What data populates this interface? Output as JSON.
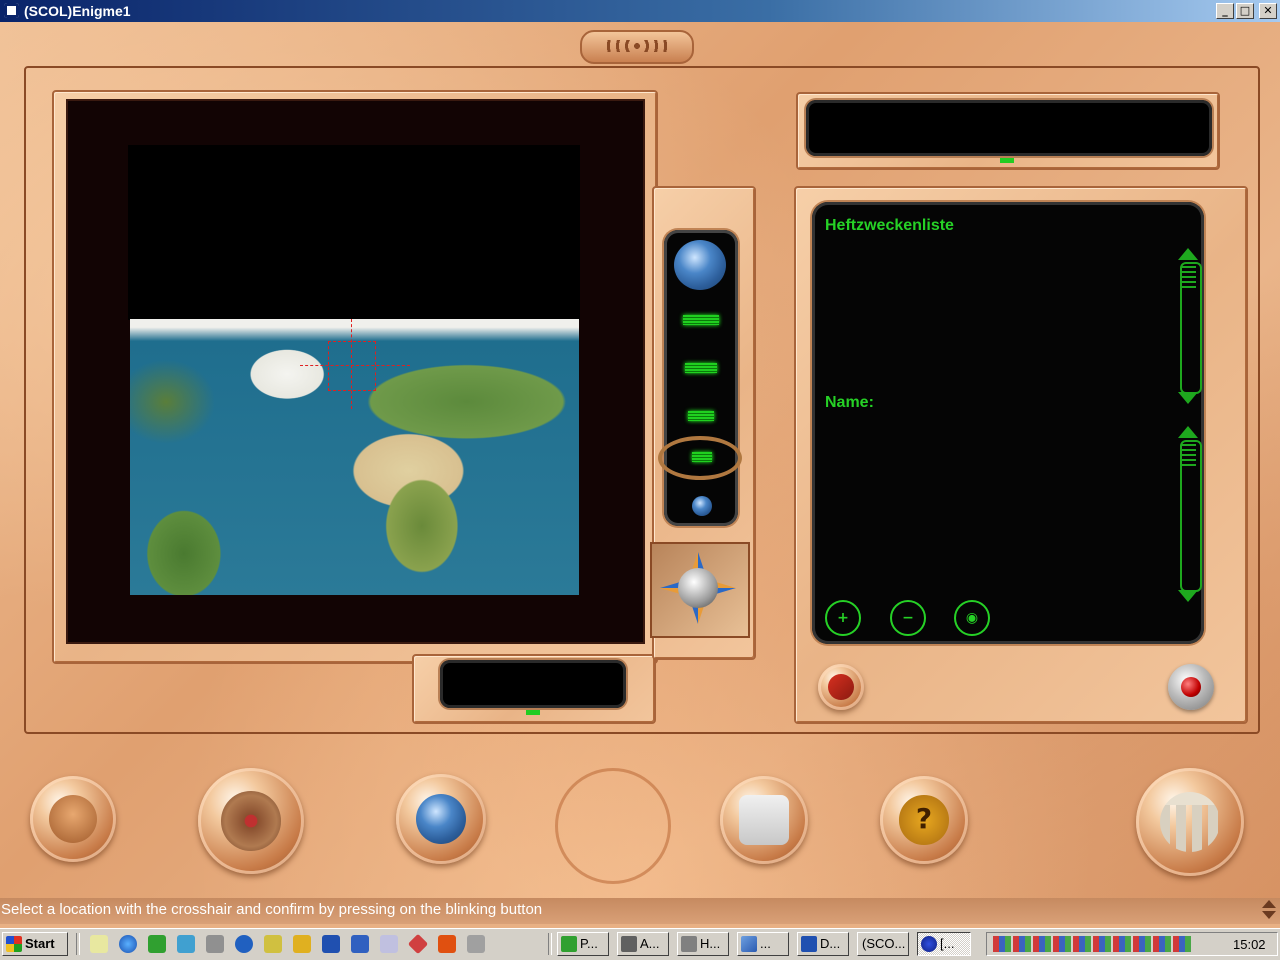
{
  "window": {
    "title": "(SCOL)Enigme1",
    "min": "_",
    "max": "□",
    "close": "✕"
  },
  "pin_panel": {
    "title": "Heftzweckenliste",
    "name_label": "Name:"
  },
  "status_bar": {
    "text": "Select a location with the crosshair and confirm by pressing on the blinking button"
  },
  "taskbar": {
    "start": "Start",
    "tasks": [
      {
        "label": "P..."
      },
      {
        "label": "A..."
      },
      {
        "label": "H..."
      },
      {
        "label": "..."
      },
      {
        "label": "D..."
      },
      {
        "label": "(SCO..."
      },
      {
        "label": "[..."
      }
    ],
    "clock": "15:02"
  },
  "icons": {
    "zoom_in": "globe-large-icon",
    "zoom_out": "globe-small-icon",
    "compass": "compass-icon",
    "add_pin": "add-pin-icon",
    "remove_pin": "remove-pin-icon",
    "view_pin": "eye-icon"
  },
  "colors": {
    "accent_green": "#26d126",
    "frame": "#e8b084"
  }
}
